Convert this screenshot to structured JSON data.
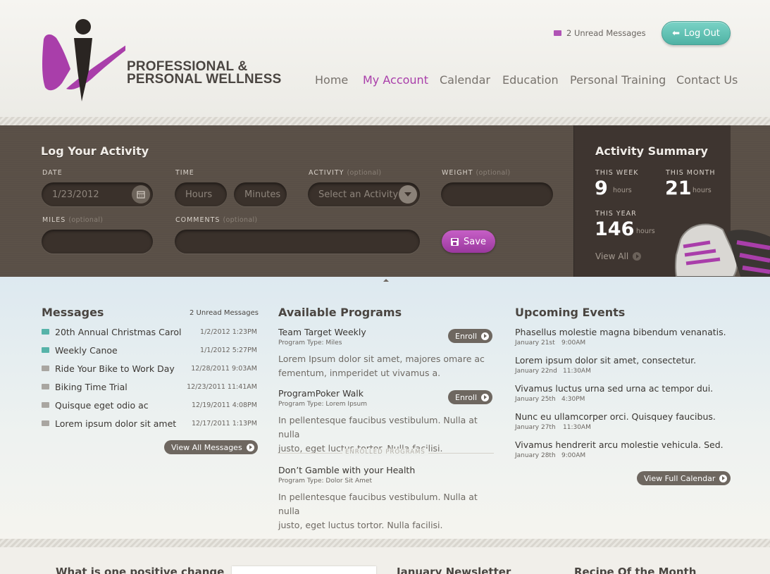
{
  "header": {
    "logo_line1": "PROFESSIONAL &",
    "logo_line2": "PERSONAL WELLNESS",
    "unread_messages": "2 Unread Messages",
    "logout_label": "Log Out",
    "nav": [
      "Home",
      "My Account",
      "Calendar",
      "Education",
      "Personal Training",
      "Contact Us"
    ],
    "nav_active": "My Account"
  },
  "activity_form": {
    "title": "Log Your Activity",
    "date_label": "DATE",
    "date_value": "1/23/2012",
    "time_label": "TIME",
    "hours_placeholder": "Hours",
    "minutes_placeholder": "Minutes",
    "activity_label": "ACTIVITY",
    "activity_optional": "(optional)",
    "activity_placeholder": "Select an Activity",
    "weight_label": "WEIGHT",
    "weight_optional": "(optional)",
    "miles_label": "MILES",
    "miles_optional": "(optional)",
    "comments_label": "COMMENTS",
    "comments_optional": "(optional)",
    "save_label": "Save"
  },
  "summary": {
    "title": "Activity Summary",
    "week_label": "THIS WEEK",
    "week_value": "9",
    "month_label": "THIS MONTH",
    "month_value": "21",
    "year_label": "THIS YEAR",
    "year_value": "146",
    "unit": "hours",
    "view_all": "View All"
  },
  "messages": {
    "title": "Messages",
    "unread": "2 Unread Messages",
    "items": [
      {
        "subject": "20th Annual Christmas Carol",
        "date": "1/2/2012 1:23PM",
        "unread": true
      },
      {
        "subject": "Weekly Canoe",
        "date": "1/1/2012 5:27PM",
        "unread": true
      },
      {
        "subject": "Ride Your Bike to Work Day",
        "date": "12/28/2011 9:03AM",
        "unread": false
      },
      {
        "subject": "Biking Time Trial",
        "date": "12/23/2011 11:41AM",
        "unread": false
      },
      {
        "subject": "Quisque eget odio ac",
        "date": "12/19/2011 4:08PM",
        "unread": false
      },
      {
        "subject": "Lorem ipsum dolor sit amet",
        "date": "12/17/2011 1:13PM",
        "unread": false
      }
    ],
    "view_all": "View All Messages"
  },
  "programs": {
    "title": "Available Programs",
    "enroll_label": "Enroll",
    "available": [
      {
        "name": "Team Target Weekly",
        "type": "Program Type: Miles",
        "desc1": "Lorem Ipsum dolor sit amet, majores omare ac",
        "desc2": "fementum, inmperidet ut vivamus a."
      },
      {
        "name": "ProgramPoker Walk",
        "type": "Program Type: Lorem Ipsum",
        "desc1": "In pellentesque faucibus vestibulum. Nulla at nulla",
        "desc2": "justo, eget luctus tortor. Nulla facilisi."
      }
    ],
    "enrolled_label": "ENROLLED PROGRAMS",
    "enrolled": [
      {
        "name": "Don’t Gamble with your Health",
        "type": "Program Type: Dolor Sit Amet",
        "desc1": "In pellentesque faucibus vestibulum. Nulla at nulla",
        "desc2": "justo, eget luctus tortor. Nulla facilisi."
      }
    ]
  },
  "events": {
    "title": "Upcoming Events",
    "items": [
      {
        "title": "Phasellus molestie magna bibendum venanatis.",
        "date": "January 21st",
        "time": "9:00AM"
      },
      {
        "title": "Lorem ipsum dolor sit amet, consectetur.",
        "date": "January 22nd",
        "time": "11:30AM"
      },
      {
        "title": "Vivamus luctus urna sed urna ac tempor dui.",
        "date": "January 25th",
        "time": "4:30PM"
      },
      {
        "title": "Nunc eu ullamcorper orci. Quisquey faucibus.",
        "date": "January 27th",
        "time": "11:30AM"
      },
      {
        "title": "Vivamus hendrerit arcu molestie vehicula. Sed.",
        "date": "January 28th",
        "time": "9:00AM"
      }
    ],
    "view_calendar": "View Full Calendar"
  },
  "footer": {
    "col1": "What is one positive change",
    "col3": "January Newsletter",
    "col4": "Recipe Of the Month"
  },
  "colors": {
    "brand": "#a93eaa",
    "accent": "#56b3a9",
    "panel": "#5b5148"
  }
}
